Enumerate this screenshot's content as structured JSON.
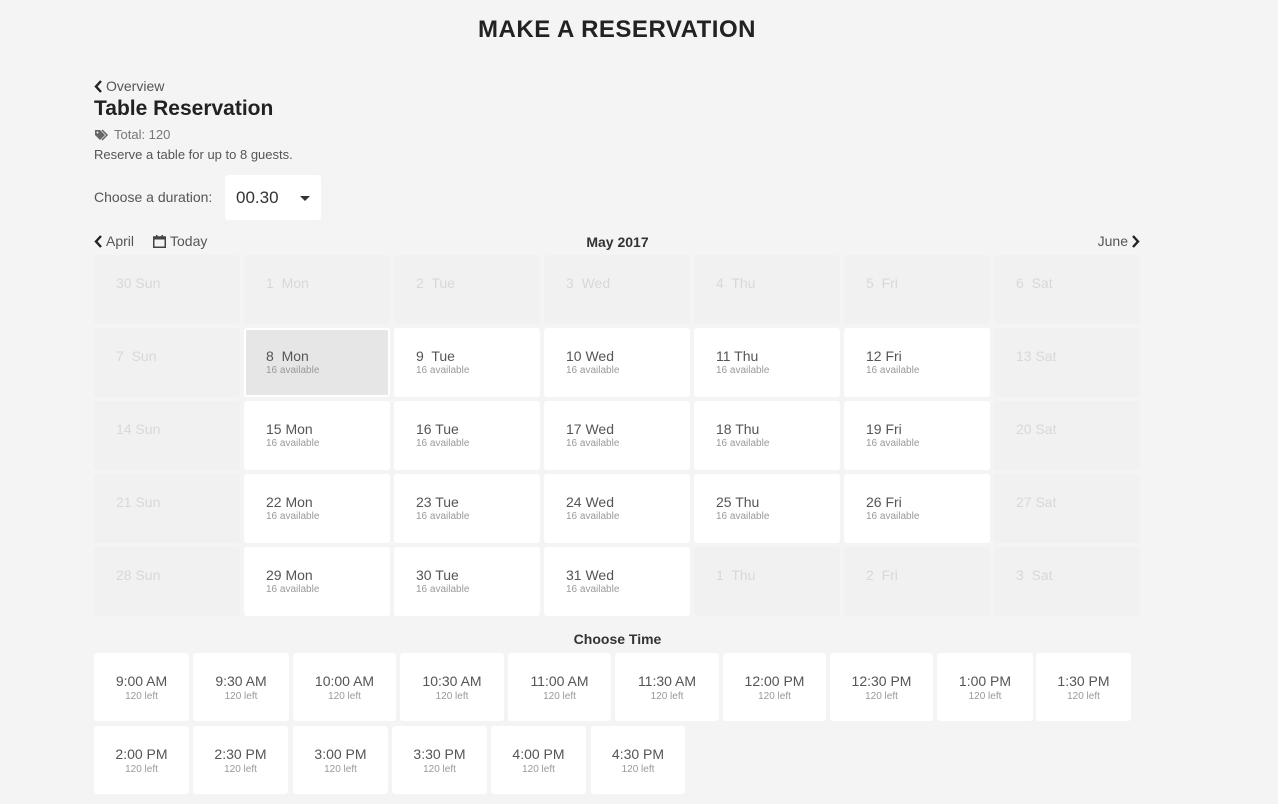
{
  "header": {
    "title": "MAKE A RESERVATION"
  },
  "back": {
    "label": "Overview"
  },
  "reservation": {
    "title": "Table Reservation",
    "total": "Total: 120",
    "description": "Reserve a table for up to 8 guests."
  },
  "duration": {
    "label": "Choose a duration:",
    "value": "00.30"
  },
  "calendar_nav": {
    "prev": "April",
    "today": "Today",
    "month": "May 2017",
    "next": "June"
  },
  "calendar": {
    "days": [
      {
        "label": "30 Sun",
        "active": false
      },
      {
        "label": "1  Mon",
        "active": false
      },
      {
        "label": "2  Tue",
        "active": false
      },
      {
        "label": "3  Wed",
        "active": false
      },
      {
        "label": "4  Thu",
        "active": false
      },
      {
        "label": "5  Fri",
        "active": false
      },
      {
        "label": "6  Sat",
        "active": false
      },
      {
        "label": "7  Sun",
        "active": false
      },
      {
        "label": "8  Mon",
        "active": true,
        "selected": true,
        "availability": "16 available"
      },
      {
        "label": "9  Tue",
        "active": true,
        "availability": "16 available"
      },
      {
        "label": "10 Wed",
        "active": true,
        "availability": "16 available"
      },
      {
        "label": "11 Thu",
        "active": true,
        "availability": "16 available"
      },
      {
        "label": "12 Fri",
        "active": true,
        "availability": "16 available"
      },
      {
        "label": "13 Sat",
        "active": false
      },
      {
        "label": "14 Sun",
        "active": false
      },
      {
        "label": "15 Mon",
        "active": true,
        "availability": "16 available"
      },
      {
        "label": "16 Tue",
        "active": true,
        "availability": "16 available"
      },
      {
        "label": "17 Wed",
        "active": true,
        "availability": "16 available"
      },
      {
        "label": "18 Thu",
        "active": true,
        "availability": "16 available"
      },
      {
        "label": "19 Fri",
        "active": true,
        "availability": "16 available"
      },
      {
        "label": "20 Sat",
        "active": false
      },
      {
        "label": "21 Sun",
        "active": false
      },
      {
        "label": "22 Mon",
        "active": true,
        "availability": "16 available"
      },
      {
        "label": "23 Tue",
        "active": true,
        "availability": "16 available"
      },
      {
        "label": "24 Wed",
        "active": true,
        "availability": "16 available"
      },
      {
        "label": "25 Thu",
        "active": true,
        "availability": "16 available"
      },
      {
        "label": "26 Fri",
        "active": true,
        "availability": "16 available"
      },
      {
        "label": "27 Sat",
        "active": false
      },
      {
        "label": "28 Sun",
        "active": false
      },
      {
        "label": "29 Mon",
        "active": true,
        "availability": "16 available"
      },
      {
        "label": "30 Tue",
        "active": true,
        "availability": "16 available"
      },
      {
        "label": "31 Wed",
        "active": true,
        "availability": "16 available"
      },
      {
        "label": "1  Thu",
        "active": false
      },
      {
        "label": "2  Fri",
        "active": false
      },
      {
        "label": "3  Sat",
        "active": false
      }
    ]
  },
  "time": {
    "heading": "Choose Time",
    "slots": [
      {
        "time": "9:00 AM",
        "left": "120 left"
      },
      {
        "time": "9:30 AM",
        "left": "120 left"
      },
      {
        "time": "10:00 AM",
        "left": "120 left"
      },
      {
        "time": "10:30 AM",
        "left": "120 left"
      },
      {
        "time": "11:00 AM",
        "left": "120 left"
      },
      {
        "time": "11:30 AM",
        "left": "120 left"
      },
      {
        "time": "12:00 PM",
        "left": "120 left"
      },
      {
        "time": "12:30 PM",
        "left": "120 left"
      },
      {
        "time": "1:00 PM",
        "left": "120 left"
      },
      {
        "time": "1:30 PM",
        "left": "120 left"
      },
      {
        "time": "2:00 PM",
        "left": "120 left"
      },
      {
        "time": "2:30 PM",
        "left": "120 left"
      },
      {
        "time": "3:00 PM",
        "left": "120 left"
      },
      {
        "time": "3:30 PM",
        "left": "120 left"
      },
      {
        "time": "4:00 PM",
        "left": "120 left"
      },
      {
        "time": "4:30 PM",
        "left": "120 left"
      }
    ]
  },
  "icons": {
    "back": "chevron-left-icon",
    "tag": "tag-icon",
    "calendar": "calendar-icon",
    "next": "chevron-right-icon",
    "dropdown": "caret-down-icon"
  }
}
